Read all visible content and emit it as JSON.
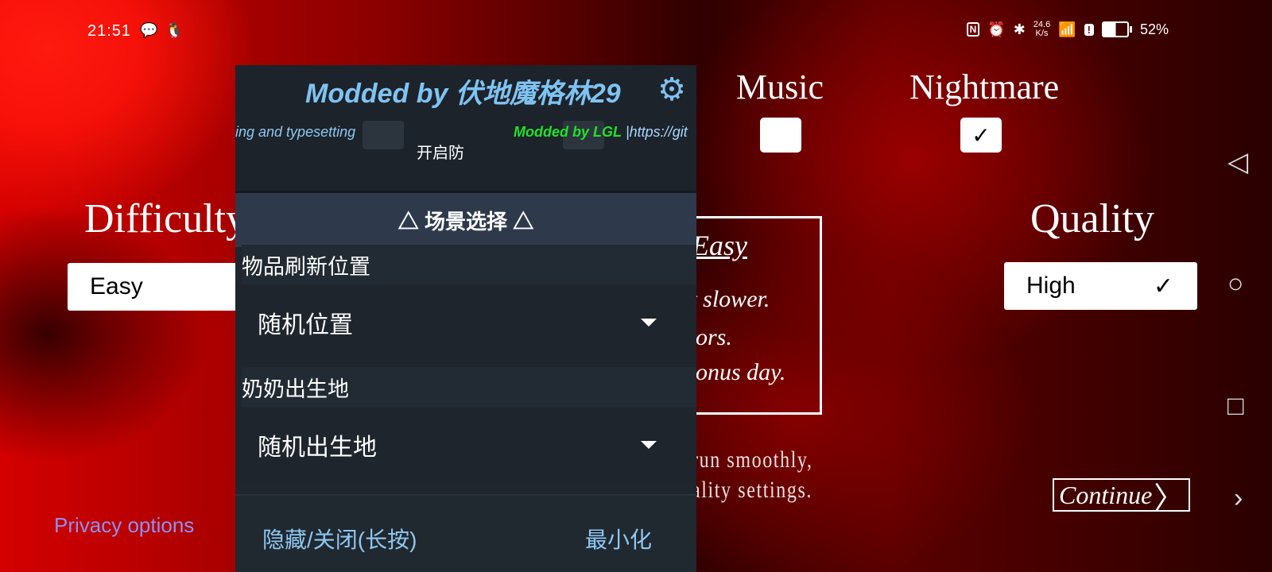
{
  "status_bar": {
    "time": "21:51",
    "left_icons": [
      "wechat-icon",
      "qq-icon"
    ],
    "right_icons": [
      "nfc-icon",
      "alarm-icon",
      "bluetooth-icon",
      "wifi-icon",
      "alert-icon",
      "battery-icon"
    ],
    "net_speed_value": "24.6",
    "net_speed_unit": "K/s",
    "battery": "52%"
  },
  "game": {
    "music_label": "Music",
    "music_checked": false,
    "nightmare_label": "Nightmare",
    "nightmare_checked": true,
    "check_mark": "✓",
    "difficulty_label": "Difficulty",
    "difficulty_value": "Easy",
    "quality_label": "Quality",
    "quality_value": "High",
    "info_title": "Easy",
    "info_lines": [
      "it slower.",
      "oors.",
      "bonus day."
    ],
    "perf_lines": [
      "run smoothly,",
      "ality settings."
    ],
    "continue_label": "Continue",
    "privacy_label": "Privacy options"
  },
  "mod_menu": {
    "title": "Modded by 伏地魔格林29",
    "marquee_left": "ing and typesetting",
    "marquee_right": "Modded by LGL",
    "marquee_url": " |https://git",
    "partial_item": "开启防",
    "section_title": "△ 场景选择 △",
    "fields": [
      {
        "label": "物品刷新位置",
        "value": "随机位置"
      },
      {
        "label": "奶奶出生地",
        "value": "随机出生地"
      }
    ],
    "hide_close_label": "隐藏/关闭(长按)",
    "minimize_label": "最小化"
  },
  "nav_bar": {
    "back": "◁",
    "home": "○",
    "recents": "□",
    "expand": "›"
  }
}
